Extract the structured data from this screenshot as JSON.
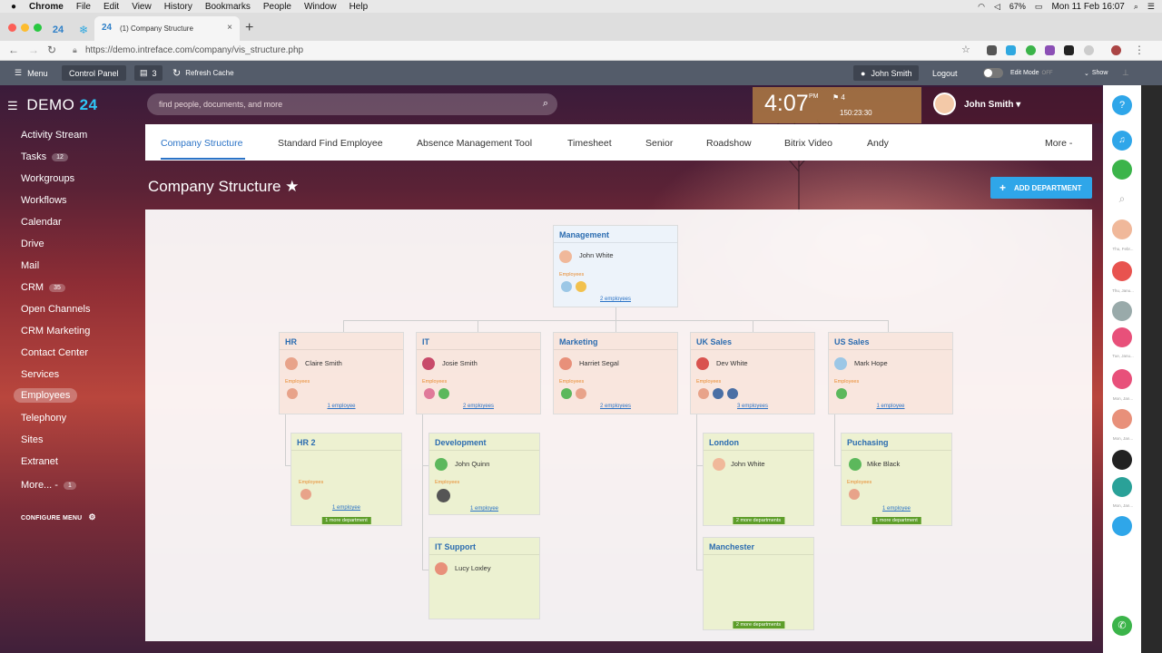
{
  "mac_menubar": {
    "apple": "",
    "items": [
      "Chrome",
      "File",
      "Edit",
      "View",
      "History",
      "Bookmarks",
      "People",
      "Window",
      "Help"
    ],
    "battery": "67%",
    "datetime": "Mon 11 Feb 16:07"
  },
  "browser": {
    "tabs": [
      {
        "label": "24"
      },
      {
        "label": "❄"
      },
      {
        "label": "(1) Company Structure",
        "favicon": "24"
      }
    ],
    "url": "https://demo.intreface.com/company/vis_structure.php"
  },
  "panel": {
    "menu": "Menu",
    "control_panel": "Control Panel",
    "notif_count": "3",
    "refresh": "Refresh Cache",
    "user": "John Smith",
    "logout": "Logout",
    "edit_mode": "Edit Mode",
    "edit_state": "OFF",
    "show": "Show"
  },
  "logo": {
    "text": "DEMO",
    "num": "24"
  },
  "sidebar": {
    "items": [
      {
        "label": "Activity Stream"
      },
      {
        "label": "Tasks",
        "count": "12"
      },
      {
        "label": "Workgroups"
      },
      {
        "label": "Workflows"
      },
      {
        "label": "Calendar"
      },
      {
        "label": "Drive"
      },
      {
        "label": "Mail"
      },
      {
        "label": "CRM",
        "count": "35"
      },
      {
        "label": "Open Channels"
      },
      {
        "label": "CRM Marketing"
      },
      {
        "label": "Contact Center"
      },
      {
        "label": "Services"
      },
      {
        "label": "Employees",
        "active": true
      },
      {
        "label": "Telephony"
      },
      {
        "label": "Sites"
      },
      {
        "label": "Extranet"
      },
      {
        "label": "More... -",
        "count": "1"
      }
    ],
    "configure": "CONFIGURE MENU"
  },
  "search": {
    "placeholder": "find people, documents, and more"
  },
  "clock": {
    "time": "4:07",
    "ampm": "PM",
    "flag_count": "4",
    "timer": "150:23:30"
  },
  "user": {
    "name": "John Smith"
  },
  "tabs": [
    "Company Structure",
    "Standard Find Employee",
    "Absence Management Tool",
    "Timesheet",
    "Senior",
    "Roadshow",
    "Bitrix Video",
    "Andy",
    "More -"
  ],
  "page": {
    "title": "Company Structure ★",
    "add_button": "ADD DEPARTMENT"
  },
  "structure": {
    "employees_label": "Employees",
    "root": {
      "name": "Management",
      "head": "John White",
      "count": "2 employees"
    },
    "level1": [
      {
        "name": "HR",
        "head": "Claire Smith",
        "count": "1 employee"
      },
      {
        "name": "IT",
        "head": "Josie Smith",
        "count": "2 employees"
      },
      {
        "name": "Marketing",
        "head": "Harriet Segal",
        "count": "2 employees"
      },
      {
        "name": "UK Sales",
        "head": "Dev White",
        "count": "3 employees"
      },
      {
        "name": "US Sales",
        "head": "Mark Hope",
        "count": "1 employee"
      }
    ],
    "level2": [
      {
        "name": "HR 2",
        "count": "1 employee",
        "more": "1 more department"
      },
      {
        "name": "Development",
        "head": "John Quinn",
        "count": "1 employee"
      },
      {
        "name": "IT Support",
        "head": "Lucy Loxley"
      },
      {
        "name": "London",
        "head": "John White",
        "more": "2 more departments"
      },
      {
        "name": "Manchester",
        "more": "2 more departments"
      },
      {
        "name": "Puchasing",
        "head": "Mike Black",
        "count": "1 employee",
        "more": "1 more department"
      }
    ]
  },
  "rail": {
    "labels": [
      "Thu, Febr...",
      "Thu, Janu...",
      "Tue, Janu...",
      "Mon, Jan...",
      "Mon, Jan...",
      "Mon, Jan..."
    ]
  },
  "colors": {
    "accent": "#2b73c6",
    "add_button": "#2fa6e9",
    "more_badge": "#5e9e2a"
  }
}
